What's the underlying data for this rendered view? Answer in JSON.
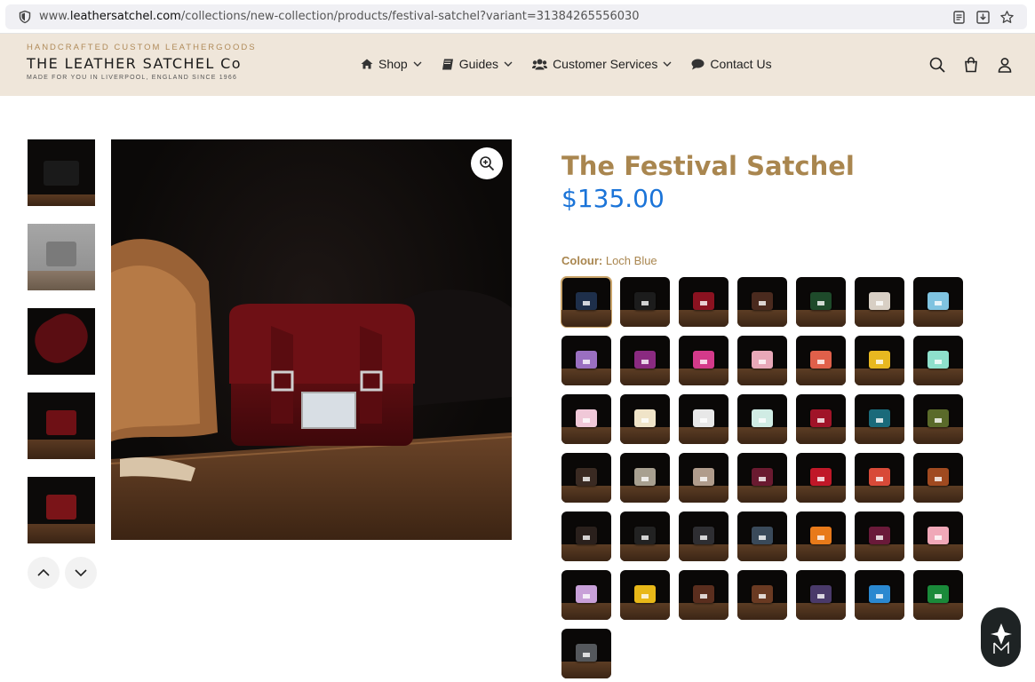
{
  "browser": {
    "url_prefix": "www.",
    "url_domain": "leathersatchel.com",
    "url_path": "/collections/new-collection/products/festival-satchel?variant=31384265556030"
  },
  "header": {
    "logo_tagline": "HANDCRAFTED CUSTOM LEATHERGOODS",
    "logo_name": "THE LEATHER SATCHEL Co",
    "logo_sub": "MADE FOR YOU IN LIVERPOOL, ENGLAND SINCE 1966",
    "nav": [
      {
        "label": "Shop",
        "icon": "home-icon"
      },
      {
        "label": "Guides",
        "icon": "book-icon"
      },
      {
        "label": "Customer Services",
        "icon": "users-icon"
      },
      {
        "label": "Contact Us",
        "icon": "comment-icon"
      }
    ]
  },
  "product": {
    "title": "The Festival Satchel",
    "price": "$135.00",
    "colour_key": "Colour:",
    "colour_value": "Loch Blue"
  },
  "thumb_colors": [
    "#1a1a1a",
    "#7a7a7a",
    "#5a0d12",
    "#6e1015",
    "#7a1418"
  ],
  "swatch_colors": [
    "#1e2f4a",
    "#1c1c1c",
    "#8a1220",
    "#4a2a1e",
    "#1e4a2a",
    "#d8cfc4",
    "#7fc3e0",
    "#9a6fc0",
    "#8a2a80",
    "#d43a8a",
    "#e8a8b8",
    "#e0604a",
    "#e8b820",
    "#8ee0cc",
    "#f0c8d8",
    "#f0e4c8",
    "#e8e8e8",
    "#d0ece4",
    "#a01428",
    "#1a6a7a",
    "#5a6a2a",
    "#3a2a22",
    "#a8a090",
    "#b09c8c",
    "#6a1a30",
    "#c01828",
    "#d84a38",
    "#a04a20",
    "#2a201c",
    "#222222",
    "#2e2e32",
    "#3a4a5a",
    "#e87a1a",
    "#6a1a3a",
    "#f0a8b8",
    "#c8a0d8",
    "#e8b818",
    "#5a2e1e",
    "#6a3a22",
    "#4a3a6a",
    "#2a88d0",
    "#1a8a3a",
    "#55585c"
  ],
  "selected_swatch_index": 0
}
